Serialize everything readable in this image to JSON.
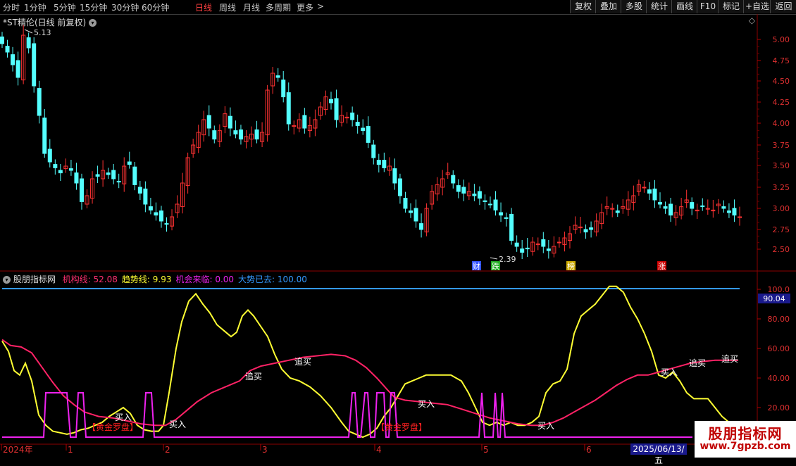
{
  "toolbar": {
    "periods": [
      {
        "label": "分时",
        "active": false
      },
      {
        "label": "1分钟",
        "active": false
      },
      {
        "label": "5分钟",
        "active": false
      },
      {
        "label": "15分钟",
        "active": false
      },
      {
        "label": "30分钟",
        "active": false
      },
      {
        "label": "60分钟",
        "active": false
      },
      {
        "label": "日线",
        "active": true
      },
      {
        "label": "周线",
        "active": false
      },
      {
        "label": "月线",
        "active": false
      },
      {
        "label": "多周期",
        "active": false
      },
      {
        "label": "更多",
        "active": false
      }
    ],
    "more_arrow": ">",
    "right_buttons": [
      "复权",
      "叠加",
      "多股",
      "统计",
      "画线",
      "F10",
      "标记",
      "+自选",
      "返回"
    ]
  },
  "chart_title": "*ST精伦(日线 前复权)",
  "price_axis": [
    "5.00",
    "4.75",
    "4.50",
    "4.25",
    "4.00",
    "3.75",
    "3.50",
    "3.25",
    "3.00",
    "2.75",
    "2.50"
  ],
  "high_label": "5.13",
  "low_label": "2.39",
  "event_tags": [
    "财",
    "跌",
    "榜",
    "涨"
  ],
  "indicator": {
    "name": "股朋指标网",
    "lines": [
      {
        "label": "机构线:",
        "value": "52.08",
        "color": "#ff3070"
      },
      {
        "label": "趋势线:",
        "value": "9.93",
        "color": "#ffff33"
      },
      {
        "label": "机会来临:",
        "value": "0.00",
        "color": "#ee22ee"
      },
      {
        "label": "大势已去:",
        "value": "100.00",
        "color": "#3399ff"
      }
    ],
    "axis": [
      "100.0",
      "80.00",
      "60.00",
      "40.00",
      "20.00"
    ],
    "current_value": "90.04",
    "signals": [
      {
        "text": "【黄金罗盘】",
        "kind": "gold"
      },
      {
        "text": "买入",
        "kind": "buy"
      },
      {
        "text": "买入",
        "kind": "buy"
      },
      {
        "text": "追买",
        "kind": "buy"
      },
      {
        "text": "追买",
        "kind": "buy"
      },
      {
        "text": "【黄金罗盘】",
        "kind": "gold"
      },
      {
        "text": "买入",
        "kind": "buy"
      },
      {
        "text": "买入",
        "kind": "buy"
      },
      {
        "text": "买入",
        "kind": "buy"
      },
      {
        "text": "追买",
        "kind": "buy"
      },
      {
        "text": "追买",
        "kind": "buy"
      }
    ]
  },
  "date_axis": [
    "2024年",
    "1",
    "2",
    "3",
    "4",
    "5",
    "6"
  ],
  "cursor_date": "2025/06/13/五",
  "watermark": {
    "title": "股朋指标网",
    "url": "www.7gpzb.com"
  },
  "colors": {
    "up": "#ff3232",
    "down": "#54ffff",
    "bg": "#000000",
    "grid": "#8b0000"
  }
}
